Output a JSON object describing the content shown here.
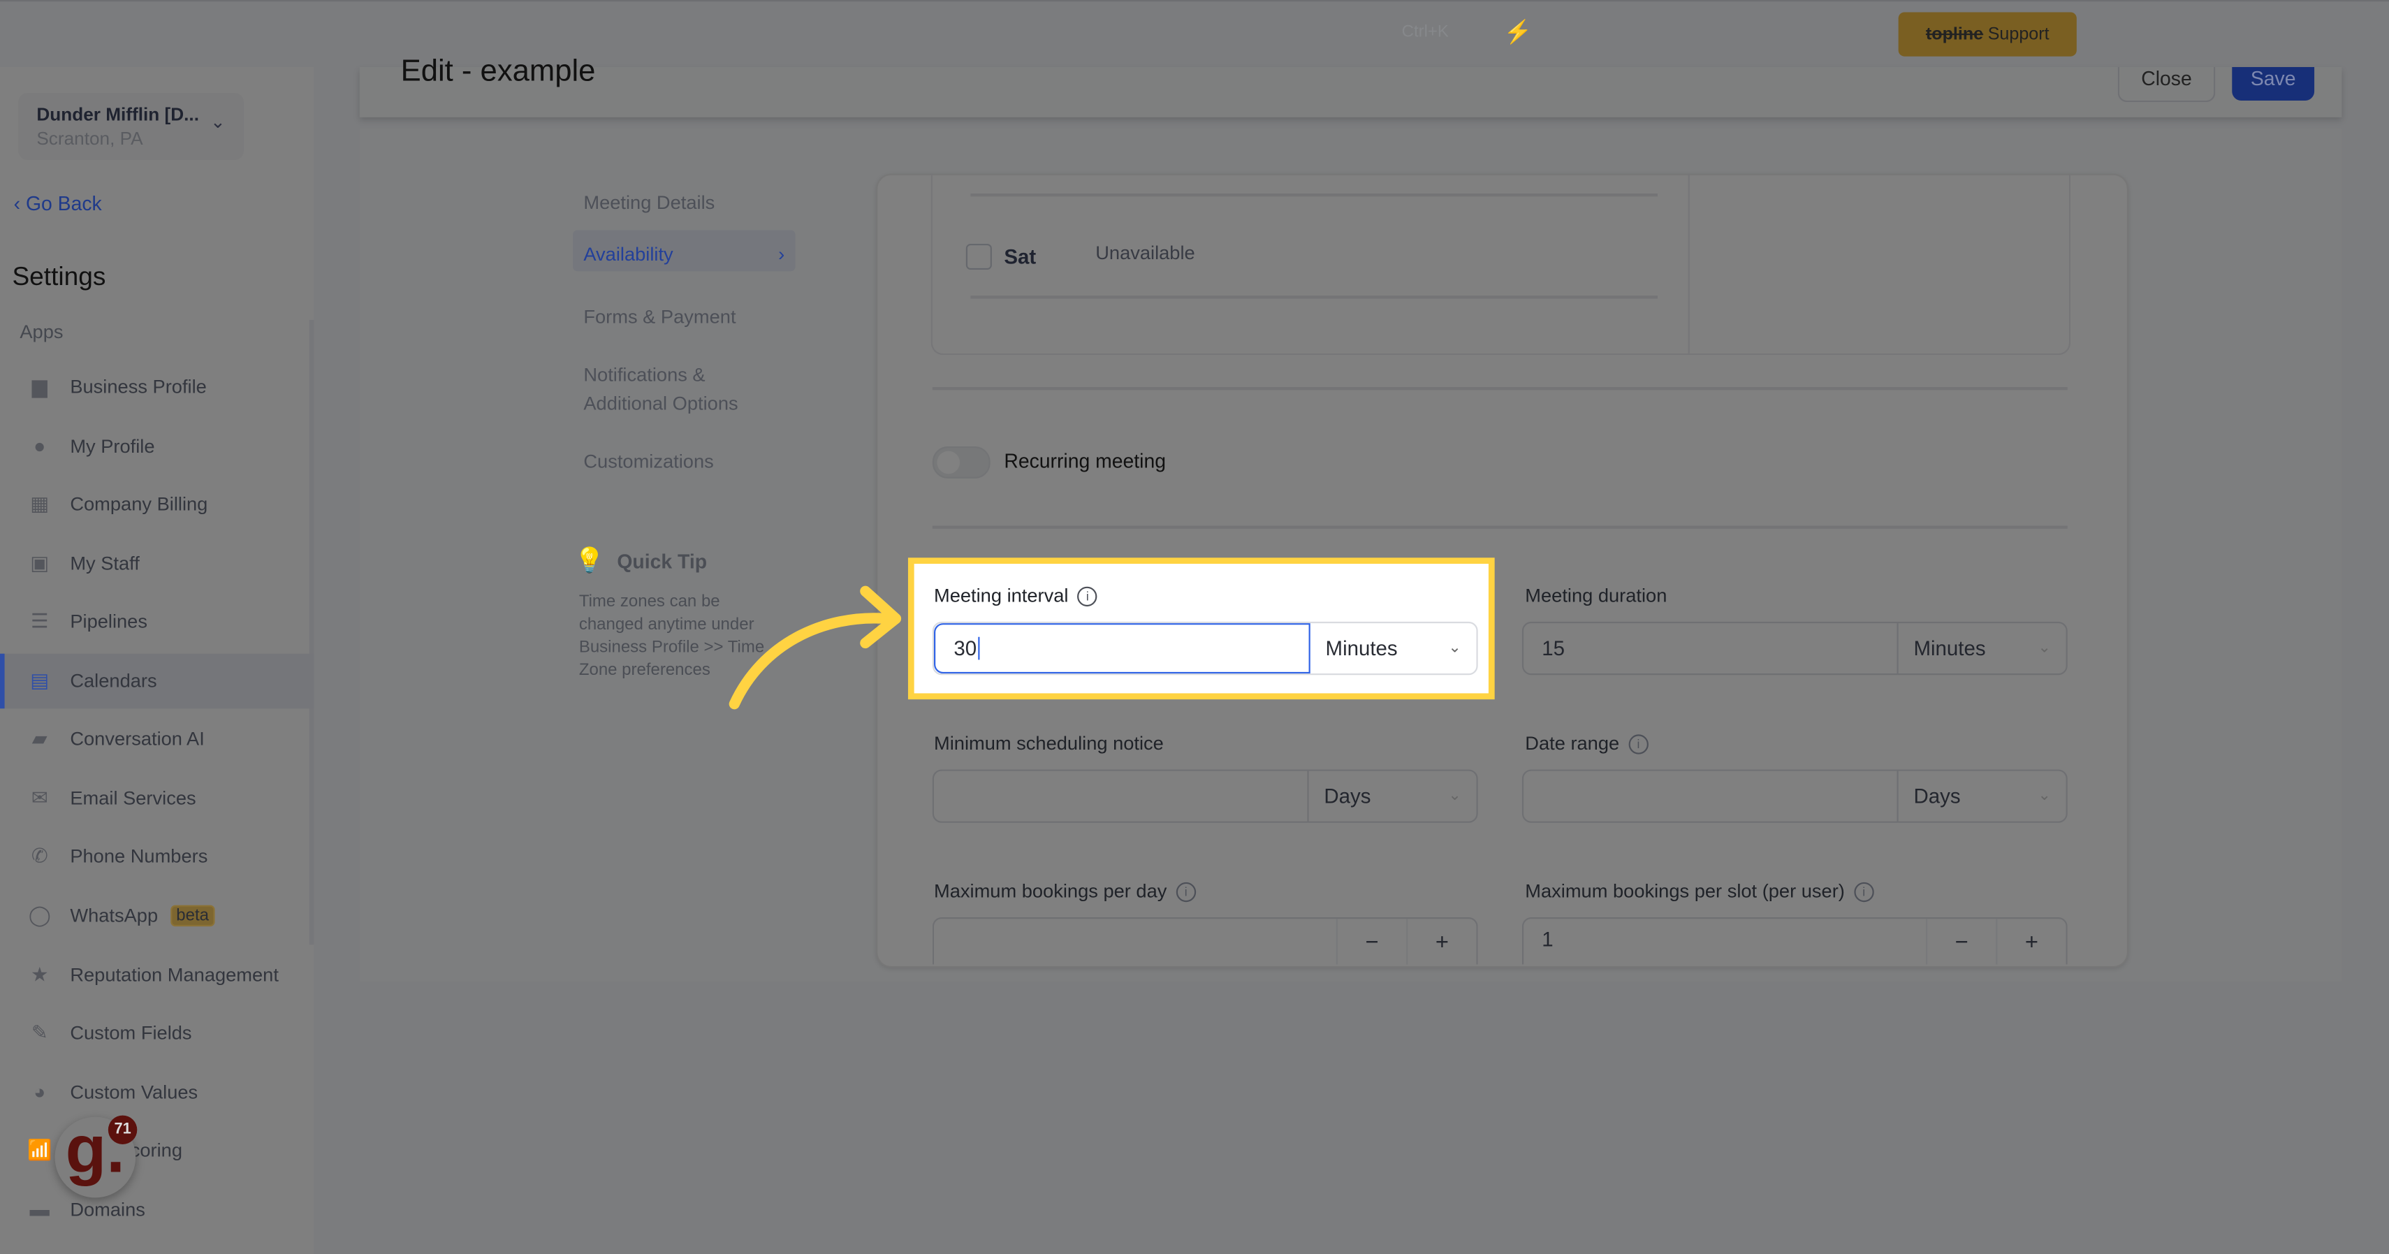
{
  "topbar": {
    "shortcut": "Ctrl+K",
    "support_brand": "topline",
    "support_label": "Support",
    "bolt_icon": "lightning-icon"
  },
  "account": {
    "name": "Dunder Mifflin [D...",
    "location": "Scranton, PA"
  },
  "sidebar": {
    "go_back": "Go Back",
    "title": "Settings",
    "section": "Apps",
    "items": [
      {
        "label": "Business Profile",
        "icon": "briefcase-icon",
        "glyph": "▆"
      },
      {
        "label": "My Profile",
        "icon": "user-icon",
        "glyph": "●"
      },
      {
        "label": "Company Billing",
        "icon": "grid-icon",
        "glyph": "▦"
      },
      {
        "label": "My Staff",
        "icon": "staff-icon",
        "glyph": "▣"
      },
      {
        "label": "Pipelines",
        "icon": "filter-icon",
        "glyph": "☰"
      },
      {
        "label": "Calendars",
        "icon": "calendar-icon",
        "glyph": "▤"
      },
      {
        "label": "Conversation AI",
        "icon": "chat-icon",
        "glyph": "▰"
      },
      {
        "label": "Email Services",
        "icon": "mail-icon",
        "glyph": "✉"
      },
      {
        "label": "Phone Numbers",
        "icon": "phone-icon",
        "glyph": "✆"
      },
      {
        "label": "WhatsApp",
        "icon": "whatsapp-icon",
        "glyph": "◯",
        "badge": "beta"
      },
      {
        "label": "Reputation Management",
        "icon": "star-icon",
        "glyph": "★"
      },
      {
        "label": "Custom Fields",
        "icon": "edit-field-icon",
        "glyph": "✎"
      },
      {
        "label": "Custom Values",
        "icon": "pie-icon",
        "glyph": "◕"
      },
      {
        "label": "Lead Scoring",
        "icon": "chart-icon",
        "glyph": "📶"
      },
      {
        "label": "Domains",
        "icon": "browser-icon",
        "glyph": "▬"
      }
    ]
  },
  "header": {
    "title": "Edit - example",
    "close": "Close",
    "save": "Save"
  },
  "tabs": [
    "Meeting Details",
    "Availability",
    "Forms & Payment",
    "Notifications & Additional Options",
    "Customizations"
  ],
  "quick_tip": {
    "title": "Quick Tip",
    "body": "Time zones can be changed anytime under Business Profile >> Time Zone preferences"
  },
  "availability": {
    "day": "Sat",
    "status": "Unavailable"
  },
  "recurring": {
    "label": "Recurring meeting",
    "enabled": false
  },
  "form": {
    "meeting_interval": {
      "label": "Meeting interval",
      "value": "30",
      "unit": "Minutes"
    },
    "meeting_duration": {
      "label": "Meeting duration",
      "value": "15",
      "unit": "Minutes"
    },
    "min_notice": {
      "label": "Minimum scheduling notice",
      "value": "",
      "unit": "Days"
    },
    "date_range": {
      "label": "Date range",
      "value": "",
      "unit": "Days"
    },
    "max_per_day": {
      "label": "Maximum bookings per day",
      "value": ""
    },
    "max_per_slot": {
      "label": "Maximum bookings per slot (per user)",
      "value": "1"
    },
    "minus": "−",
    "plus": "+"
  },
  "chat_widget": {
    "logo": "g.",
    "count": "71"
  },
  "colors": {
    "highlight": "#ffd342",
    "focus": "#2f63e6",
    "save": "#172f78"
  }
}
